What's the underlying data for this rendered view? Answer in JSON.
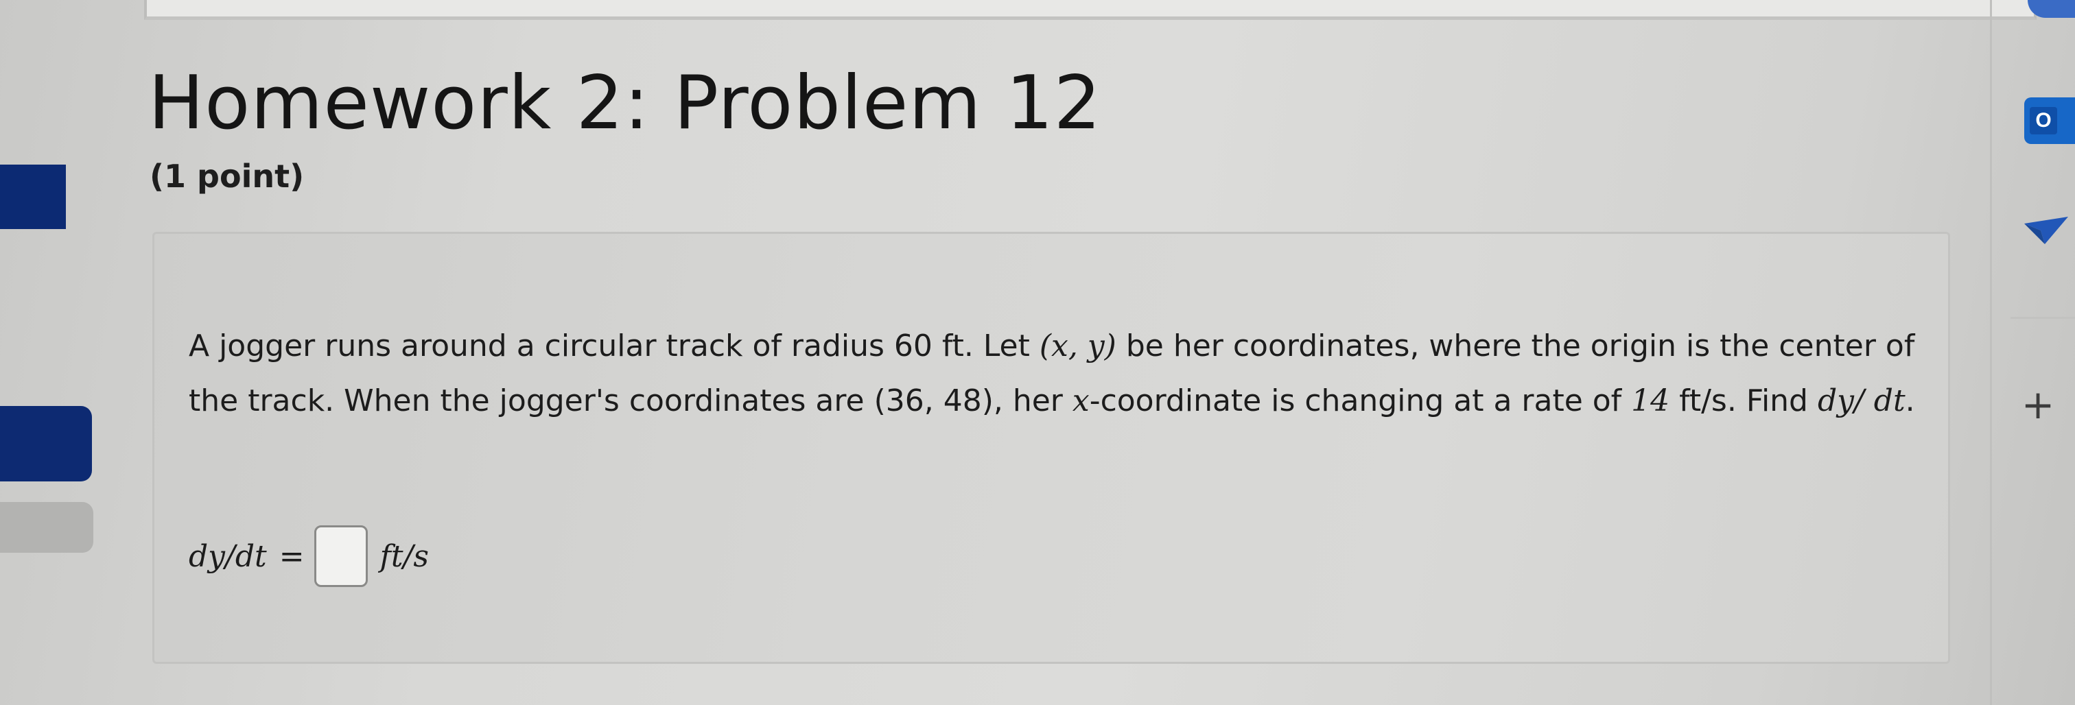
{
  "page": {
    "title": "Homework 2: Problem 12",
    "points": "(1 point)"
  },
  "problem": {
    "text_1": "A jogger runs around a circular track of radius 60 ft. Let ",
    "math_xy": "(x, y)",
    "text_2": " be her coordinates, where the origin is the center of the track. When the jogger's coordinates are (36, 48), her ",
    "math_x": "x",
    "text_3": "-coordinate is changing at a rate of ",
    "math_rate": "14",
    "text_4": " ft/s. Find ",
    "math_dydt": "dy/ dt",
    "text_5": "."
  },
  "answer": {
    "lhs": "dy/dt",
    "equals": "=",
    "value": "",
    "unit": "ft/s"
  },
  "right_rail": {
    "outlook_letter": "O",
    "plus_label": "+"
  },
  "colors": {
    "rail_accent": "#0c2a73",
    "outlook_blue": "#1767c7"
  },
  "icons": [
    "outlook-icon",
    "send-icon",
    "add-icon"
  ]
}
